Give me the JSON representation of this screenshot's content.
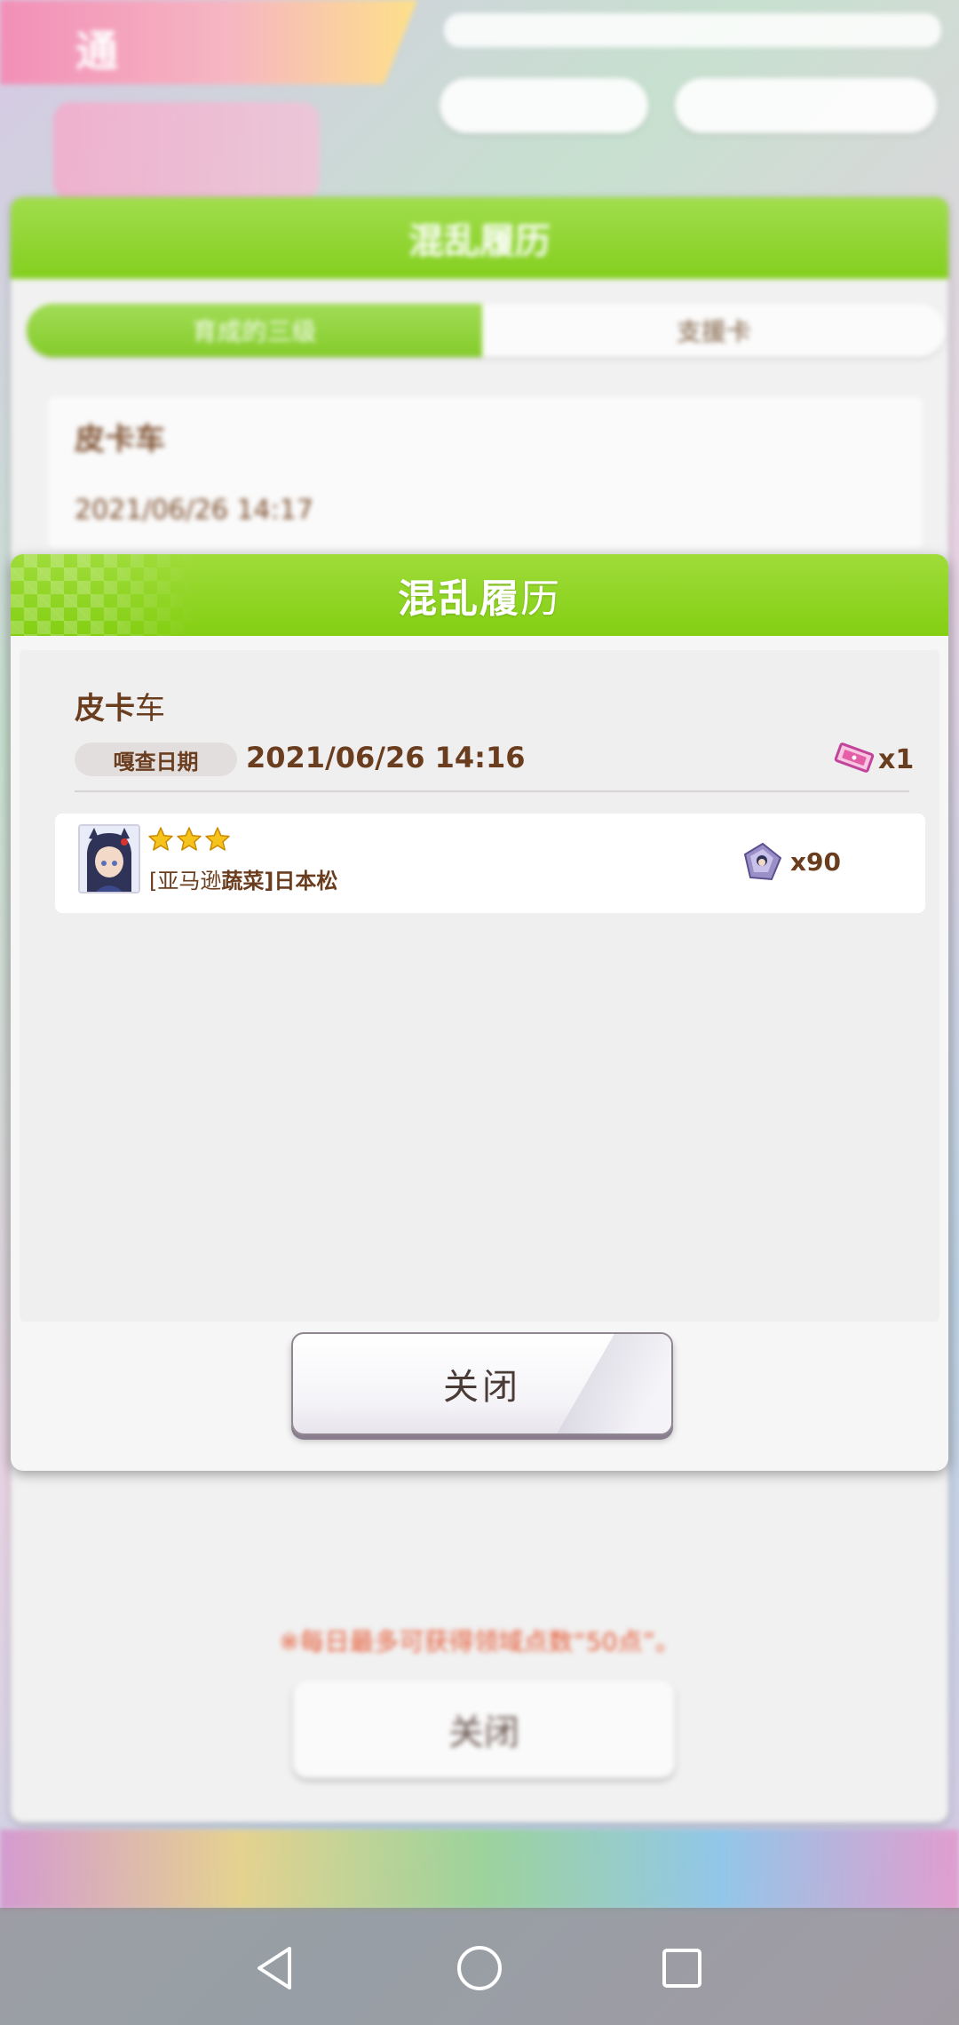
{
  "background": {
    "top_label": "通",
    "panel_title": "混乱履历",
    "tabs": [
      "育成的三级",
      "支援卡"
    ],
    "card_name": "皮卡车",
    "card_date": "2021/06/26 14:17",
    "note": "※每日最多可获得领域点数“50点”。",
    "close_label": "关闭"
  },
  "modal": {
    "title_bold": "混乱履",
    "title_light": "历",
    "record": {
      "name_bold": "皮卡",
      "name_light": "车",
      "date_label": "嘎查日期",
      "date_value": "2021/06/26 14:16",
      "ticket_count": "x1"
    },
    "items": [
      {
        "stars": 3,
        "name_prefix": "[亚马逊",
        "name_mid": "蔬菜",
        "name_suffix": "]日本松",
        "count": "x90"
      }
    ],
    "close_label": "关闭"
  },
  "icons": {
    "ticket": "ticket-icon",
    "shard": "character-shard-icon",
    "star": "star-icon",
    "nav_back": "back-triangle-icon",
    "nav_home": "home-circle-icon",
    "nav_recents": "recents-square-icon"
  },
  "colors": {
    "header_green": "#84cf13",
    "text_brown": "#6b3d1f",
    "star_gold": "#f6c21c",
    "ticket_pink": "#e45fa8"
  }
}
